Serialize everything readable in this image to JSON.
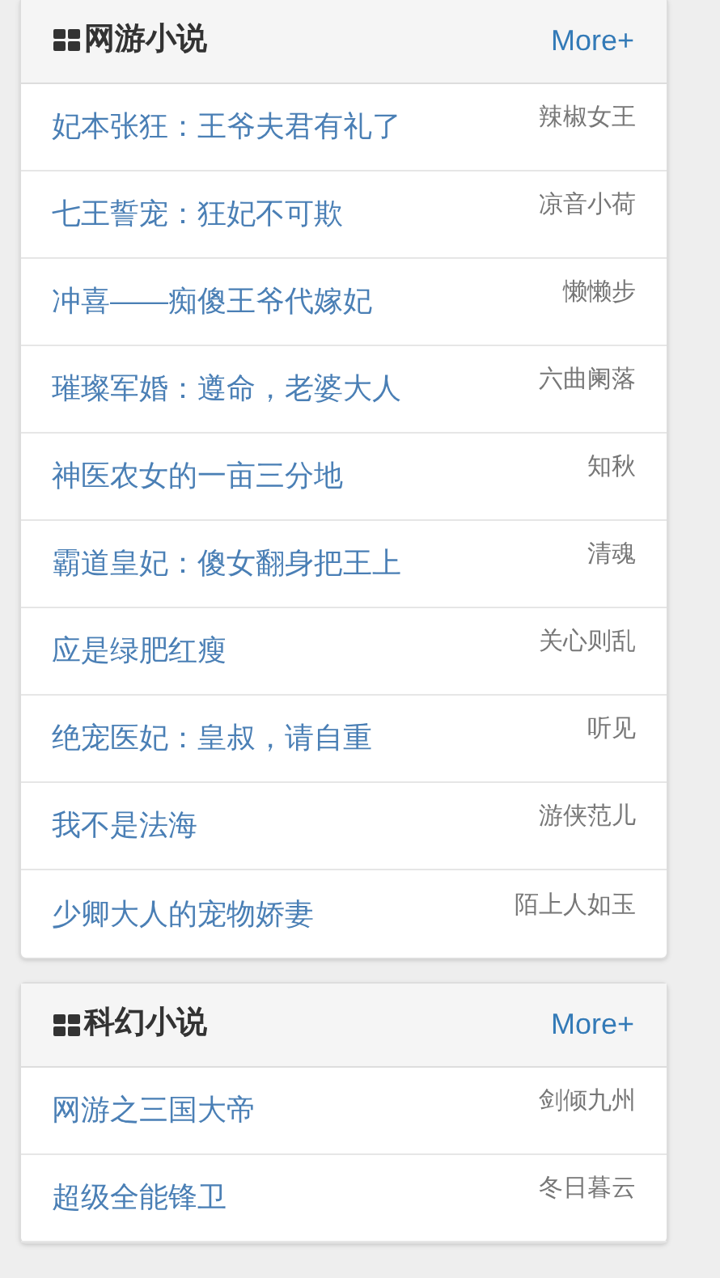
{
  "panels": [
    {
      "title": "网游小说",
      "more": "More+",
      "books": [
        {
          "title": "妃本张狂：王爷夫君有礼了",
          "author": "辣椒女王"
        },
        {
          "title": "七王誓宠：狂妃不可欺",
          "author": "凉音小荷"
        },
        {
          "title": "冲喜——痴傻王爷代嫁妃",
          "author": "懒懒步"
        },
        {
          "title": "璀璨军婚：遵命，老婆大人",
          "author": "六曲阑落"
        },
        {
          "title": "神医农女的一亩三分地",
          "author": "知秋"
        },
        {
          "title": "霸道皇妃：傻女翻身把王上",
          "author": "清魂"
        },
        {
          "title": "应是绿肥红瘦",
          "author": "关心则乱"
        },
        {
          "title": "绝宠医妃：皇叔，请自重",
          "author": "听见"
        },
        {
          "title": "我不是法海",
          "author": "游侠范儿"
        },
        {
          "title": "少卿大人的宠物娇妻",
          "author": "陌上人如玉"
        }
      ]
    },
    {
      "title": "科幻小说",
      "more": "More+",
      "books": [
        {
          "title": "网游之三国大帝",
          "author": "剑倾九州"
        },
        {
          "title": "超级全能锋卫",
          "author": "冬日暮云"
        }
      ]
    }
  ]
}
